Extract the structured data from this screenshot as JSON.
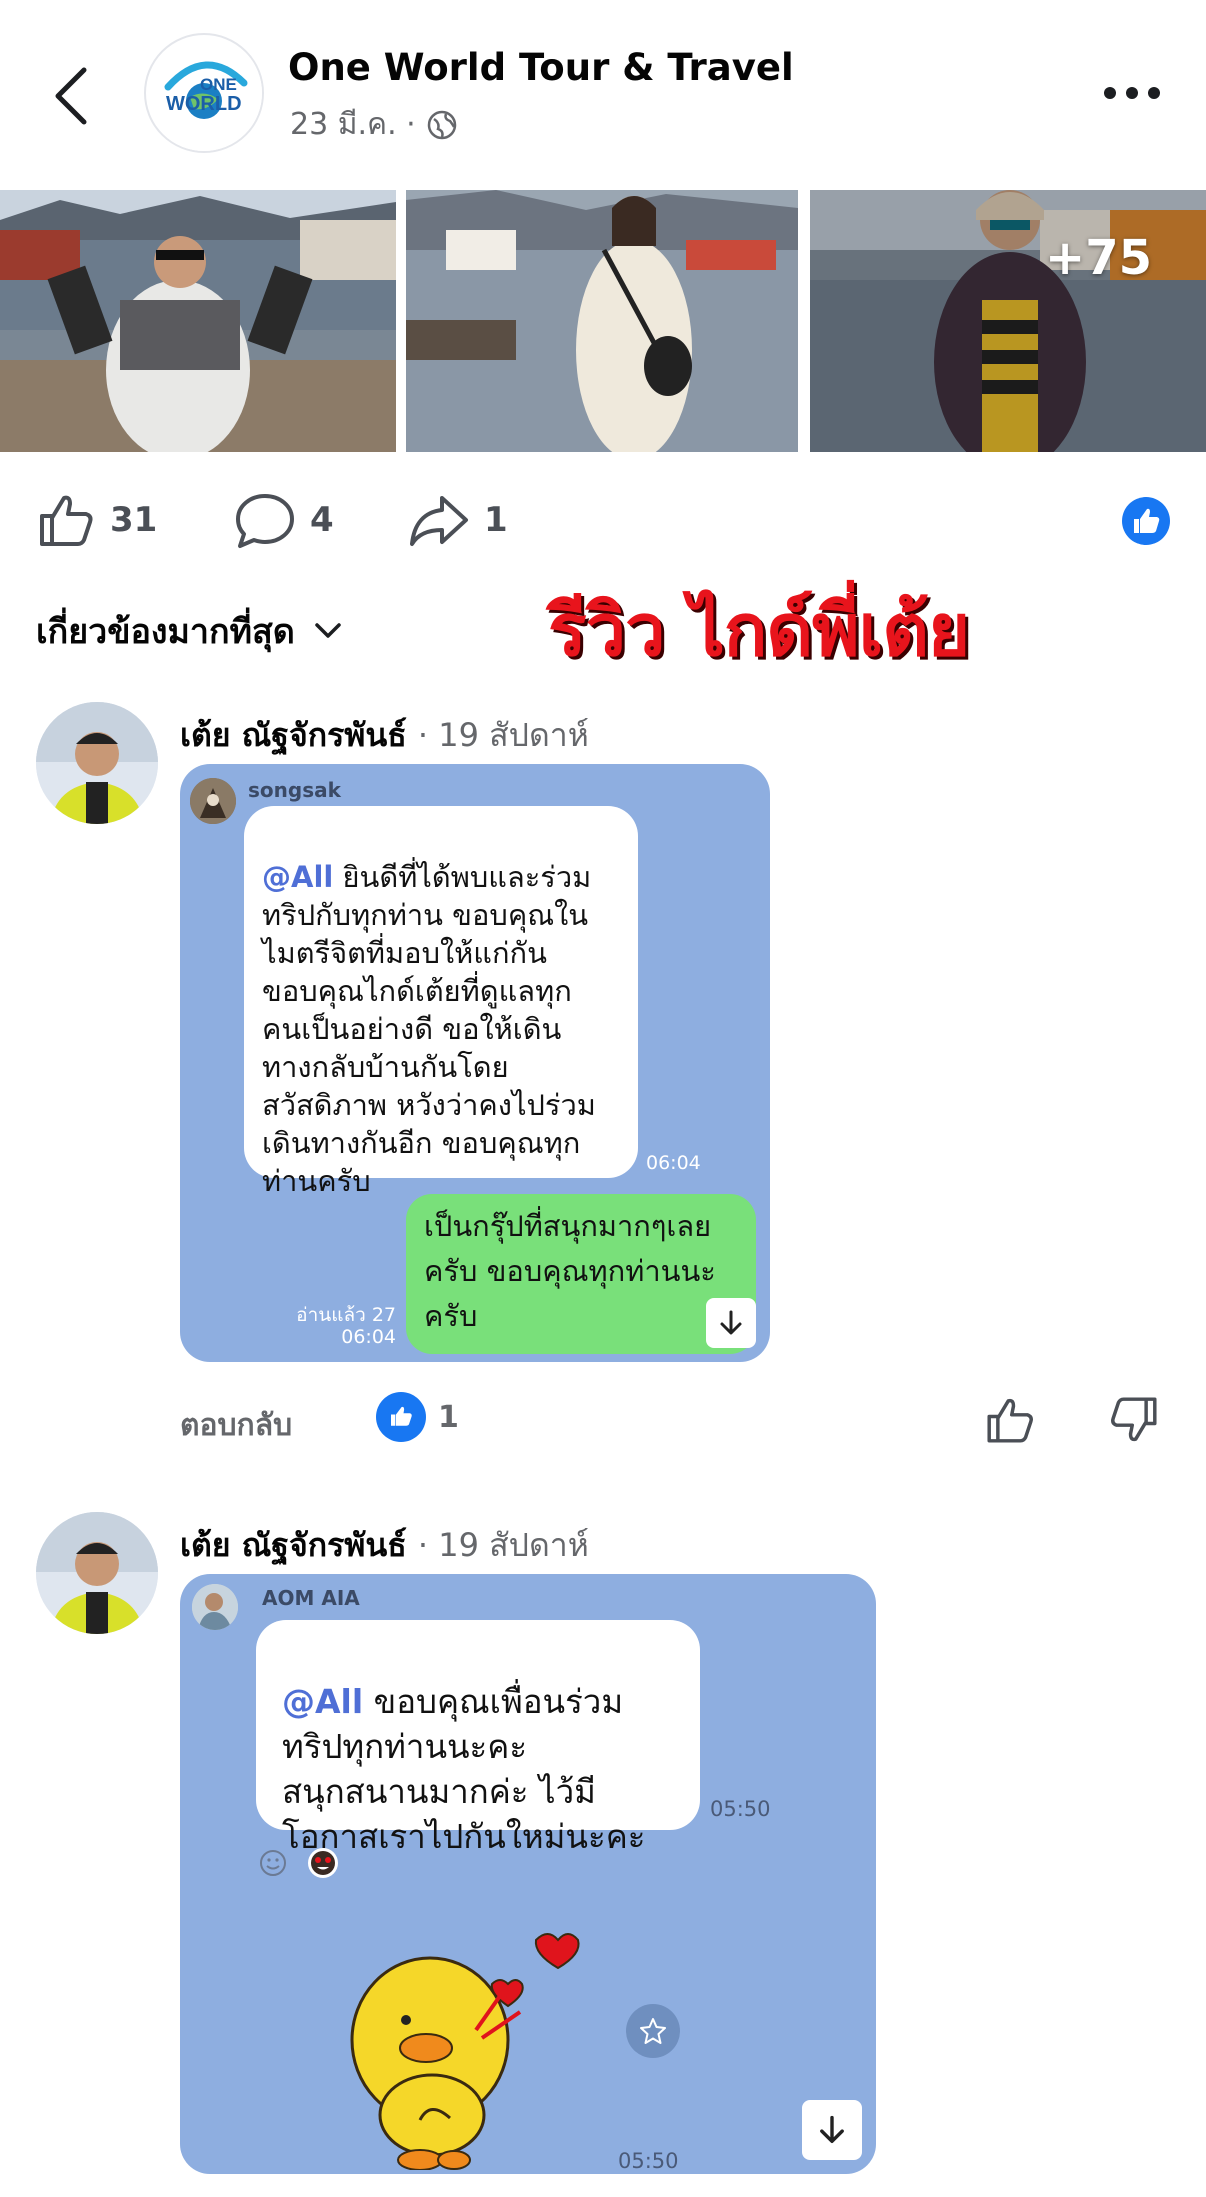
{
  "header": {
    "page_name": "One World Tour & Travel",
    "date": "23 มี.ค. ·",
    "logo_text_top": "ONE",
    "logo_text_bottom": "WORLD"
  },
  "photos": {
    "more_count": "+75"
  },
  "reactions": {
    "likes": "31",
    "comments": "4",
    "shares": "1"
  },
  "filter": {
    "label": "เกี่ยวข้องมากที่สุด"
  },
  "overlay_title": "รีวิว ไกด์พี่เต้ย",
  "comments": [
    {
      "author": "เต้ย ณัฐจักรพันธ์",
      "time": "· 19 สัปดาห์",
      "chat": {
        "sender": "songsak",
        "mention": "@All",
        "message": " ยินดีที่ได้พบและร่วม\nทริปกับทุกท่าน ขอบคุณใน\nไมตรีจิตที่มอบให้แก่กัน\nขอบคุณไกด์เต้ยที่ดูแลทุก\nคนเป็นอย่างดี ขอให้เดิน\nทางกลับบ้านกันโดย\nสวัสดิภาพ หวังว่าคงไปร่วม\nเดินทางกันอีก ขอบคุณทุก\nท่านครับ",
        "message_time": "06:04",
        "reply": "เป็นกรุ๊ปที่สนุกมากๆเลย\nครับ ขอบคุณทุกท่านนะ\nครับ",
        "read_status": "อ่านแล้ว 27\n06:04"
      },
      "reply_label": "ตอบกลับ",
      "like_count": "1"
    },
    {
      "author": "เต้ย ณัฐจักรพันธ์",
      "time": "· 19 สัปดาห์",
      "chat": {
        "sender": "AOM AIA",
        "mention": "@All",
        "message": " ขอบคุณเพื่อนร่วม\nทริปทุกท่านนะคะ\nสนุกสนานมากค่ะ ไว้มี\nโอกาสเราไปกันใหม่นะคะ",
        "message_time": "05:50",
        "sticker_time": "05:50"
      }
    }
  ],
  "colors": {
    "facebook_blue": "#1877f2",
    "line_background": "#8eaee0",
    "line_green": "#79e07a",
    "overlay_red": "#e8141c"
  }
}
